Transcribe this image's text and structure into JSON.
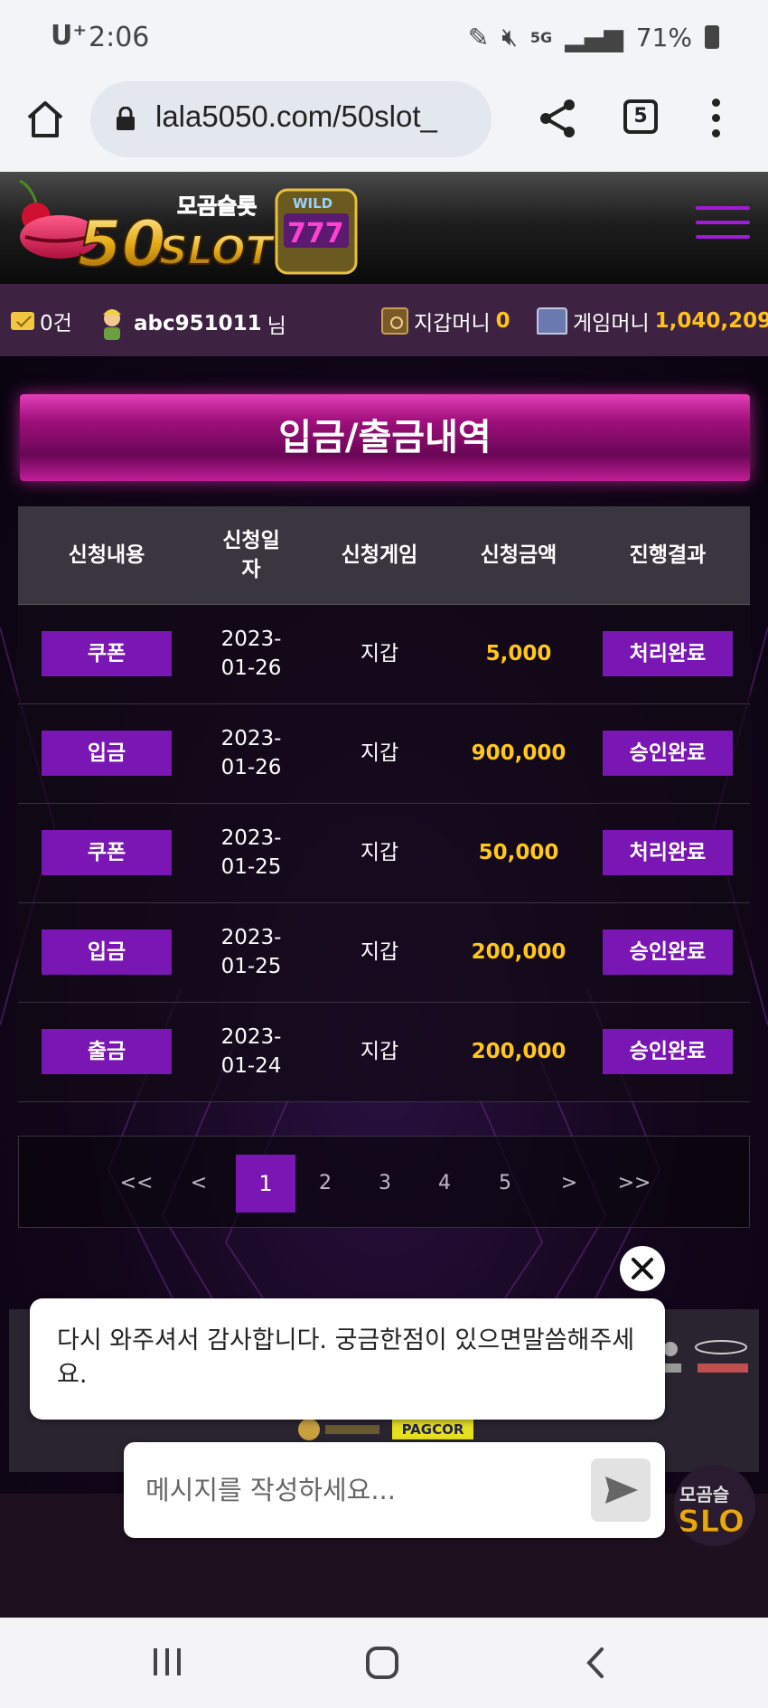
{
  "status_bar": {
    "carrier": "U⁺",
    "time": "2:06",
    "network": "5G",
    "battery": "71%"
  },
  "browser": {
    "url": "lala5050.com/50slot_",
    "tab_count": "5"
  },
  "site": {
    "logo_text": "모곰슬롯 50SLOT",
    "accent_color": "#7a16b4",
    "gold_color": "#ffc71c"
  },
  "info_bar": {
    "messages": "0건",
    "username": "abc951011",
    "username_suffix": "님",
    "wallet_label": "지갑머니",
    "wallet_value": "0",
    "game_label": "게임머니",
    "game_value": "1,040,209"
  },
  "page": {
    "title": "입금/출금내역"
  },
  "table": {
    "headers": [
      "신청내용",
      "신청일\n자",
      "신청게임",
      "신청금액",
      "진행결과"
    ],
    "rows": [
      {
        "type": "쿠폰",
        "date_y": "2023-",
        "date_md": "01-26",
        "game": "지갑",
        "amount": "5,000",
        "result": "처리완료"
      },
      {
        "type": "입금",
        "date_y": "2023-",
        "date_md": "01-26",
        "game": "지갑",
        "amount": "900,000",
        "result": "승인완료"
      },
      {
        "type": "쿠폰",
        "date_y": "2023-",
        "date_md": "01-25",
        "game": "지갑",
        "amount": "50,000",
        "result": "처리완료"
      },
      {
        "type": "입금",
        "date_y": "2023-",
        "date_md": "01-25",
        "game": "지갑",
        "amount": "200,000",
        "result": "승인완료"
      },
      {
        "type": "출금",
        "date_y": "2023-",
        "date_md": "01-24",
        "game": "지갑",
        "amount": "200,000",
        "result": "승인완료"
      }
    ]
  },
  "pagination": {
    "first": "<<",
    "prev": "<",
    "pages": [
      "1",
      "2",
      "3",
      "4",
      "5"
    ],
    "current": "1",
    "next": ">",
    "last": ">>"
  },
  "footer": {
    "pagcor": "PAGCOR"
  },
  "chat": {
    "message": "다시 와주셔서 감사합니다. 궁금한점이 있으면말씀해주세요.",
    "placeholder": "메시지를 작성하세요..."
  }
}
